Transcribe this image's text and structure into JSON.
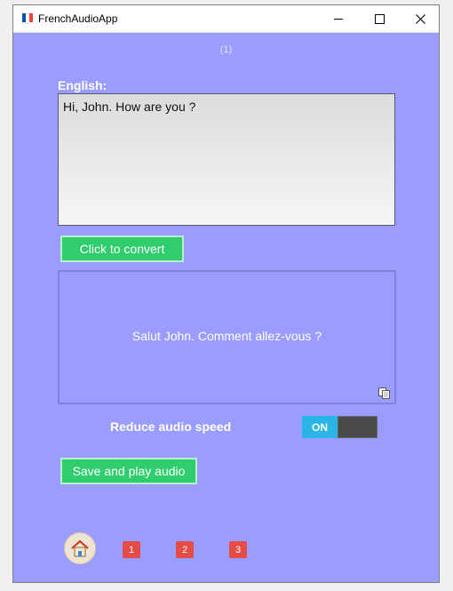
{
  "window": {
    "title": "FrenchAudioApp",
    "icon_name": "french-flag-icon",
    "flag_colors": [
      "#0055a4",
      "#ffffff",
      "#ef4135"
    ]
  },
  "controls": {
    "minimize_icon": "minimize-icon",
    "maximize_icon": "maximize-icon",
    "close_icon": "close-icon"
  },
  "counter": "(1)",
  "english": {
    "label": "English:",
    "text": "Hi, John. How are you ?"
  },
  "convert_button": "Click to convert",
  "french": {
    "text": "Salut John. Comment allez-vous ?",
    "copy_icon": "copy-icon"
  },
  "reduce_audio": {
    "label": "Reduce audio speed",
    "toggle_on_label": "ON",
    "state": "on",
    "on_color": "#29b6e6"
  },
  "save_button": "Save and play audio",
  "nav": {
    "home_icon": "home-icon",
    "pages": [
      "1",
      "2",
      "3"
    ],
    "page_color": "#e74b45"
  },
  "colors": {
    "background": "#9a9cff",
    "button_green": "#2fcd6d"
  }
}
